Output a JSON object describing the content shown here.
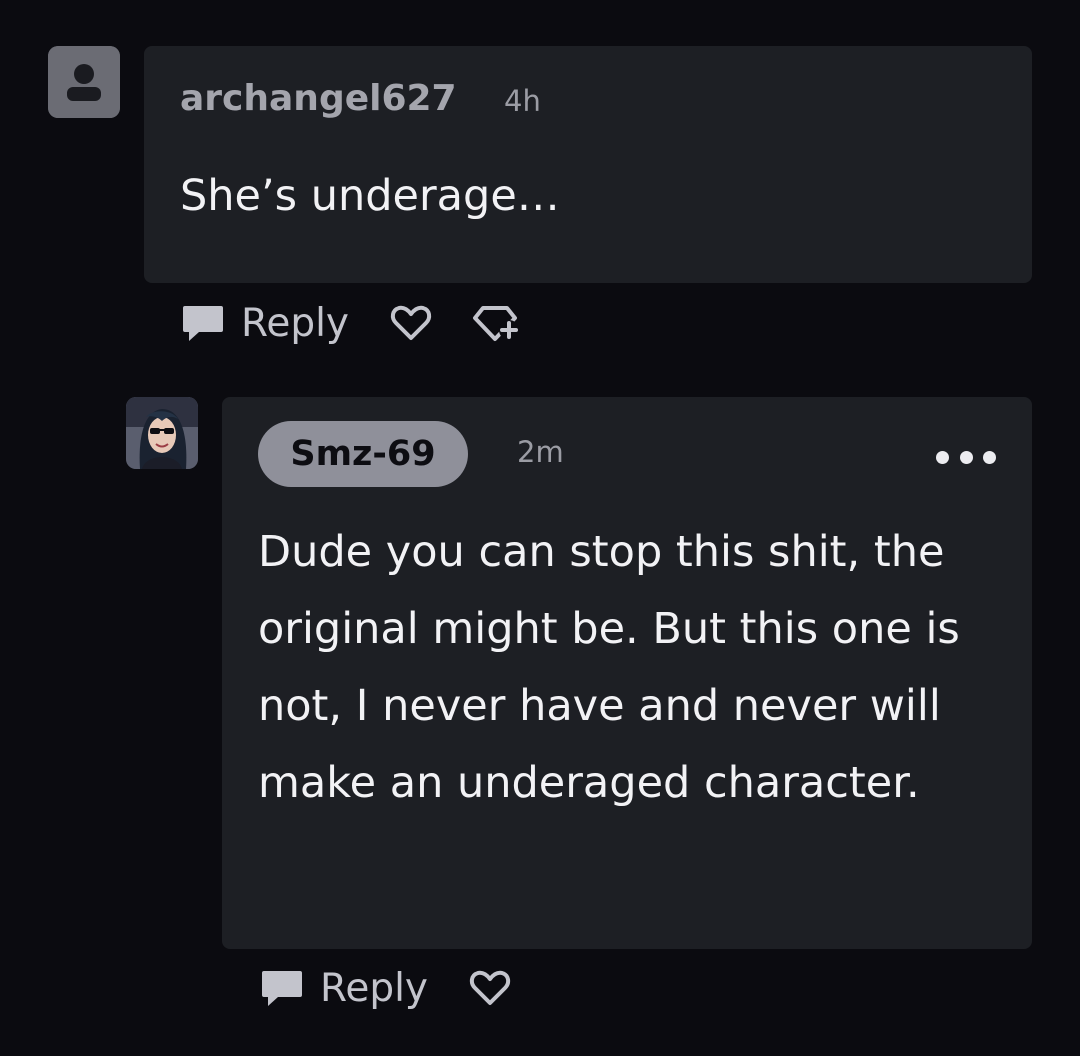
{
  "comments": [
    {
      "username": "archangel627",
      "time": "4h",
      "text": "She’s underage…",
      "avatar": "default-user-icon",
      "actions": {
        "reply_label": "Reply",
        "icons": [
          "chat-bubble-icon",
          "heart-icon",
          "award-add-icon"
        ]
      }
    },
    {
      "username": "Smz-69",
      "time": "2m",
      "text": "Dude you can stop this shit, the original might be. But this one is not, I never have and never will make an underaged character.",
      "avatar": "user-photo",
      "actions": {
        "reply_label": "Reply",
        "icons": [
          "chat-bubble-icon",
          "heart-icon",
          "more-options-icon"
        ]
      }
    }
  ],
  "colors": {
    "background": "#0b0b10",
    "bubble": "#1d1f24",
    "username_pill": "#8f909a",
    "muted_text": "#9b9ca4",
    "primary_text": "#f2f2f5"
  }
}
